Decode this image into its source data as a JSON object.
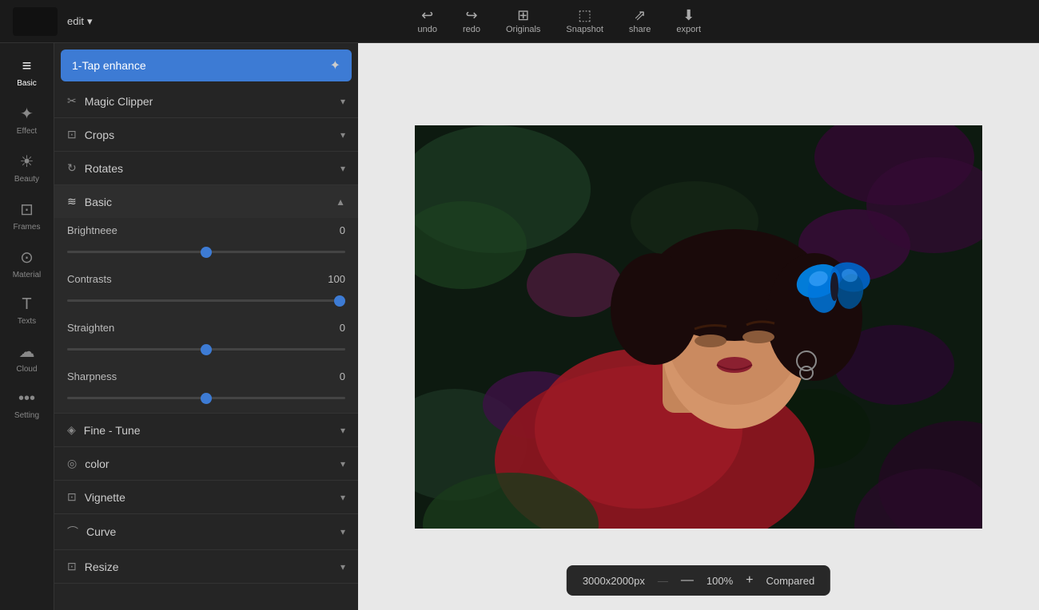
{
  "header": {
    "edit_label": "edit",
    "chevron": "▾",
    "tools": [
      {
        "id": "undo",
        "icon": "↩",
        "label": "undo"
      },
      {
        "id": "redo",
        "icon": "↪",
        "label": "redo"
      },
      {
        "id": "originals",
        "icon": "⊞",
        "label": "Originals"
      },
      {
        "id": "snapshot",
        "icon": "⬚",
        "label": "Snapshot"
      },
      {
        "id": "share",
        "icon": "⇗",
        "label": "share"
      },
      {
        "id": "export",
        "icon": "⬇",
        "label": "export"
      }
    ]
  },
  "icon_sidebar": {
    "items": [
      {
        "id": "basic",
        "icon": "≡",
        "label": "Basic",
        "active": true
      },
      {
        "id": "effect",
        "icon": "✦",
        "label": "Effect"
      },
      {
        "id": "beauty",
        "icon": "☀",
        "label": "Beauty"
      },
      {
        "id": "frames",
        "icon": "⊡",
        "label": "Frames"
      },
      {
        "id": "material",
        "icon": "⊙",
        "label": "Material"
      },
      {
        "id": "texts",
        "icon": "T",
        "label": "Texts"
      },
      {
        "id": "cloud",
        "icon": "☁",
        "label": "Cloud"
      },
      {
        "id": "setting",
        "icon": "•••",
        "label": "Setting"
      }
    ]
  },
  "panel": {
    "one_tap": {
      "label": "1-Tap enhance",
      "icon": "✦"
    },
    "sections": [
      {
        "id": "magic-clipper",
        "icon": "✂",
        "label": "Magic Clipper",
        "expanded": false
      },
      {
        "id": "crops",
        "icon": "⊡",
        "label": "Crops",
        "expanded": false
      },
      {
        "id": "rotates",
        "icon": "↻",
        "label": "Rotates",
        "expanded": false
      },
      {
        "id": "basic",
        "icon": "≋",
        "label": "Basic",
        "expanded": true
      },
      {
        "id": "fine-tune",
        "icon": "◈",
        "label": "Fine - Tune",
        "expanded": false
      },
      {
        "id": "color",
        "icon": "◎",
        "label": "color",
        "expanded": false
      },
      {
        "id": "vignette",
        "icon": "⊡",
        "label": "Vignette",
        "expanded": false
      },
      {
        "id": "curve",
        "icon": "⌒",
        "label": "Curve",
        "expanded": false
      },
      {
        "id": "resize",
        "icon": "⊡",
        "label": "Resize",
        "expanded": false
      }
    ],
    "basic_sliders": [
      {
        "id": "brightness",
        "label": "Brightneee",
        "value": 0,
        "min": -100,
        "max": 100,
        "fill_pct": 63
      },
      {
        "id": "contrasts",
        "label": "Contrasts",
        "value": 100,
        "min": -100,
        "max": 100,
        "fill_pct": 100
      },
      {
        "id": "straighten",
        "label": "Straighten",
        "value": 0,
        "min": -100,
        "max": 100,
        "fill_pct": 63
      },
      {
        "id": "sharpness",
        "label": "Sharpness",
        "value": 0,
        "min": -100,
        "max": 100,
        "fill_pct": 63
      }
    ]
  },
  "canvas": {
    "dimensions": "3000x2000px",
    "zoom": "100%",
    "compared_label": "Compared"
  },
  "bottom_bar": {
    "dimensions": "3000x2000px",
    "zoom": "100%",
    "minus_label": "—",
    "plus_label": "+",
    "compared_label": "Compared"
  }
}
